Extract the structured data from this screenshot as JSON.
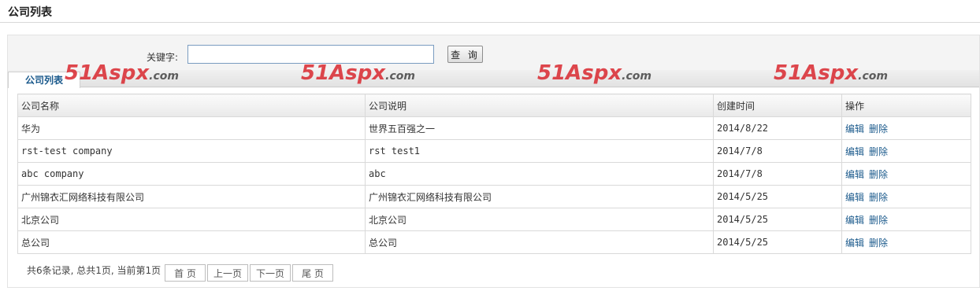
{
  "page": {
    "title": "公司列表"
  },
  "search": {
    "label": "关键字:",
    "value": "",
    "placeholder": "",
    "button": "查 询"
  },
  "tab": {
    "label": "公司列表"
  },
  "table": {
    "headers": [
      "公司名称",
      "公司说明",
      "创建时间",
      "操作"
    ],
    "rows": [
      {
        "name": "华为",
        "desc": "世界五百强之一",
        "date": "2014/8/22",
        "edit": "编辑",
        "delete": "删除"
      },
      {
        "name": "rst-test company",
        "desc": "rst test1",
        "date": "2014/7/8",
        "edit": "编辑",
        "delete": "删除"
      },
      {
        "name": "abc company",
        "desc": "abc",
        "date": "2014/7/8",
        "edit": "编辑",
        "delete": "删除"
      },
      {
        "name": "广州锦衣汇网络科技有限公司",
        "desc": "广州锦衣汇网络科技有限公司",
        "date": "2014/5/25",
        "edit": "编辑",
        "delete": "删除"
      },
      {
        "name": "北京公司",
        "desc": "北京公司",
        "date": "2014/5/25",
        "edit": "编辑",
        "delete": "删除"
      },
      {
        "name": "总公司",
        "desc": "总公司",
        "date": "2014/5/25",
        "edit": "编辑",
        "delete": "删除"
      }
    ]
  },
  "pager": {
    "info": "共6条记录, 总共1页, 当前第1页",
    "first": "首 页",
    "prev": "上一页",
    "next": "下一页",
    "last": "尾 页"
  },
  "watermark": {
    "main": "51Aspx",
    "sub": ".com"
  },
  "colors": {
    "link": "#1b5a8c",
    "watermark": "#d9282f"
  }
}
